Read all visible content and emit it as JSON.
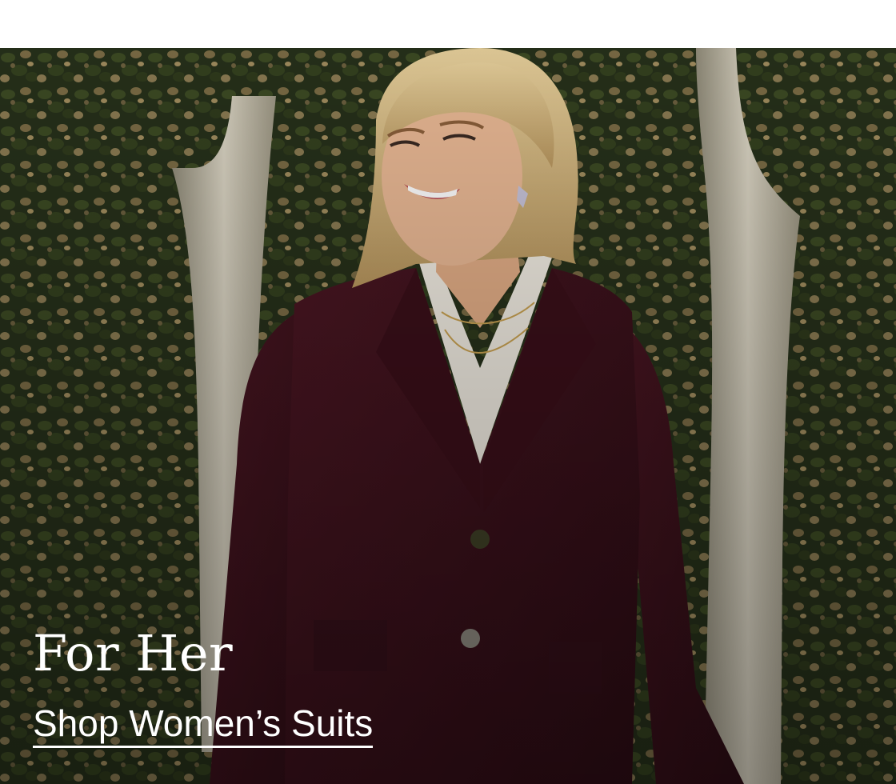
{
  "hero": {
    "title": "For Her",
    "link_label": "Shop Women’s Suits"
  }
}
